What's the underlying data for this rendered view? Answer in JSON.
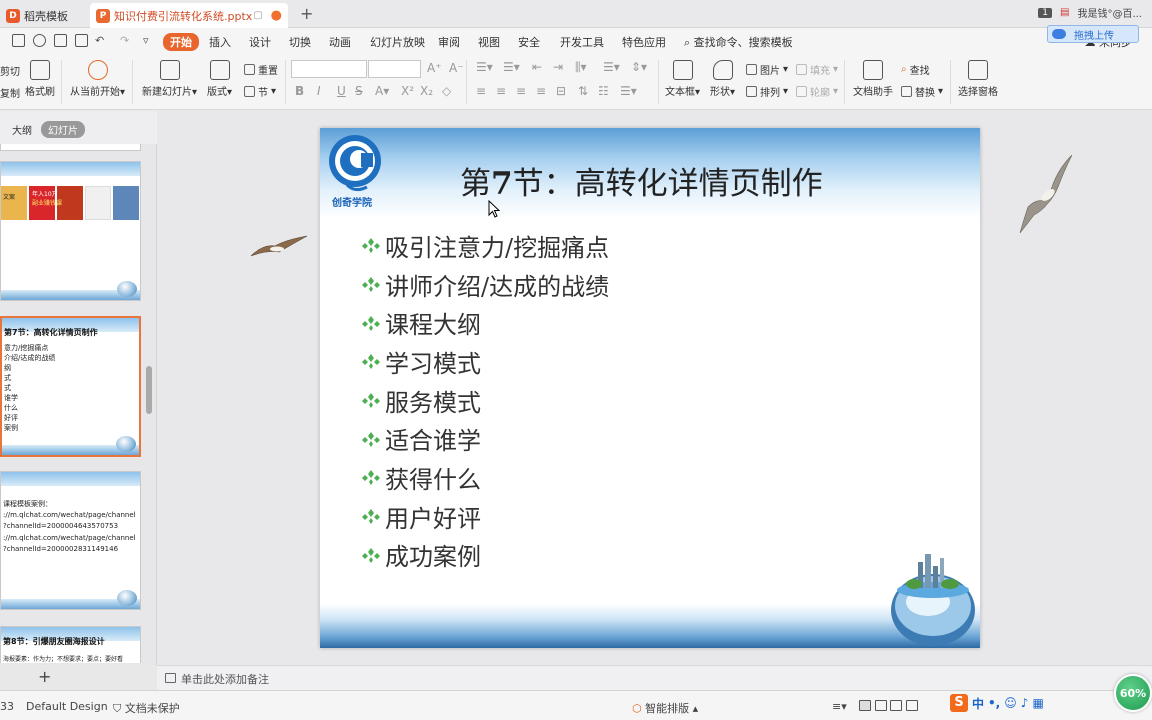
{
  "titlebar": {
    "home_tab": "稻壳模板",
    "doc_tab": "知识付费引流转化系统.pptx",
    "page_num": "1",
    "user_name": "我是钱°@百..."
  },
  "menu": {
    "tabs": [
      "开始",
      "插入",
      "设计",
      "切换",
      "动画",
      "幻灯片放映",
      "审阅",
      "视图",
      "安全",
      "开发工具",
      "特色应用"
    ],
    "search": "查找命令、搜索模板",
    "sync": "未同步",
    "upload_popup": "拖拽上传"
  },
  "ribbon": {
    "cut": "剪切",
    "copy": "复制",
    "format_painter": "格式刷",
    "from_current": "从当前开始",
    "new_slide": "新建幻灯片",
    "layout": "版式",
    "reset": "重置",
    "section": "节",
    "textbox": "文本框",
    "shape": "形状",
    "picture": "图片",
    "fill": "填充",
    "arrange": "排列",
    "outline": "轮廓",
    "doc_helper": "文档助手",
    "find": "查找",
    "replace": "替换",
    "select_pane": "选择窗格"
  },
  "leftpanel": {
    "tab_outline": "大纲",
    "tab_slides": "幻灯片",
    "thumb1": {
      "poster_text": [
        "年入10万",
        "副业赚钱课",
        "文案"
      ]
    },
    "thumb2": {
      "title": "第7节：高转化详情页制作",
      "lines": [
        "意力/挖掘痛点",
        "介绍/达成的战绩",
        "纲",
        "式",
        "式",
        "谁学",
        "什么",
        "好评",
        "案例"
      ]
    },
    "thumb3": {
      "lines": [
        "课程模板案例：",
        "://m.qlchat.com/wechat/page/channel",
        "?channelId=2000004643570753",
        "://m.qlchat.com/wechat/page/channel",
        "?channelId=2000002831149146"
      ]
    },
    "thumb4": {
      "title": "第8节：引爆朋友圈海报设计",
      "line": "海报要素：作为力；不想要求；要点；要好看"
    }
  },
  "slide": {
    "logo_text": "创奇学院",
    "title_pre": "第",
    "title_num": "7",
    "title_post": "节：高转化详情页制作",
    "bullets": [
      "吸引注意力/挖掘痛点",
      "讲师介绍/达成的战绩",
      "课程大纲",
      "学习模式",
      "服务模式",
      "适合谁学",
      "获得什么",
      "用户好评",
      "成功案例"
    ]
  },
  "notes": {
    "placeholder": "单击此处添加备注"
  },
  "status": {
    "slide_indicator": "33",
    "design": "Default Design",
    "protect": "文档未保护",
    "smart_layout": "智能排版",
    "zoom": "60%",
    "ime_lang": "中"
  },
  "colors": {
    "accent": "#e8662e",
    "bullet_green": "#4caf50",
    "slide_blue": "#2e6aa5",
    "zoom_green": "#1e9a4f"
  }
}
